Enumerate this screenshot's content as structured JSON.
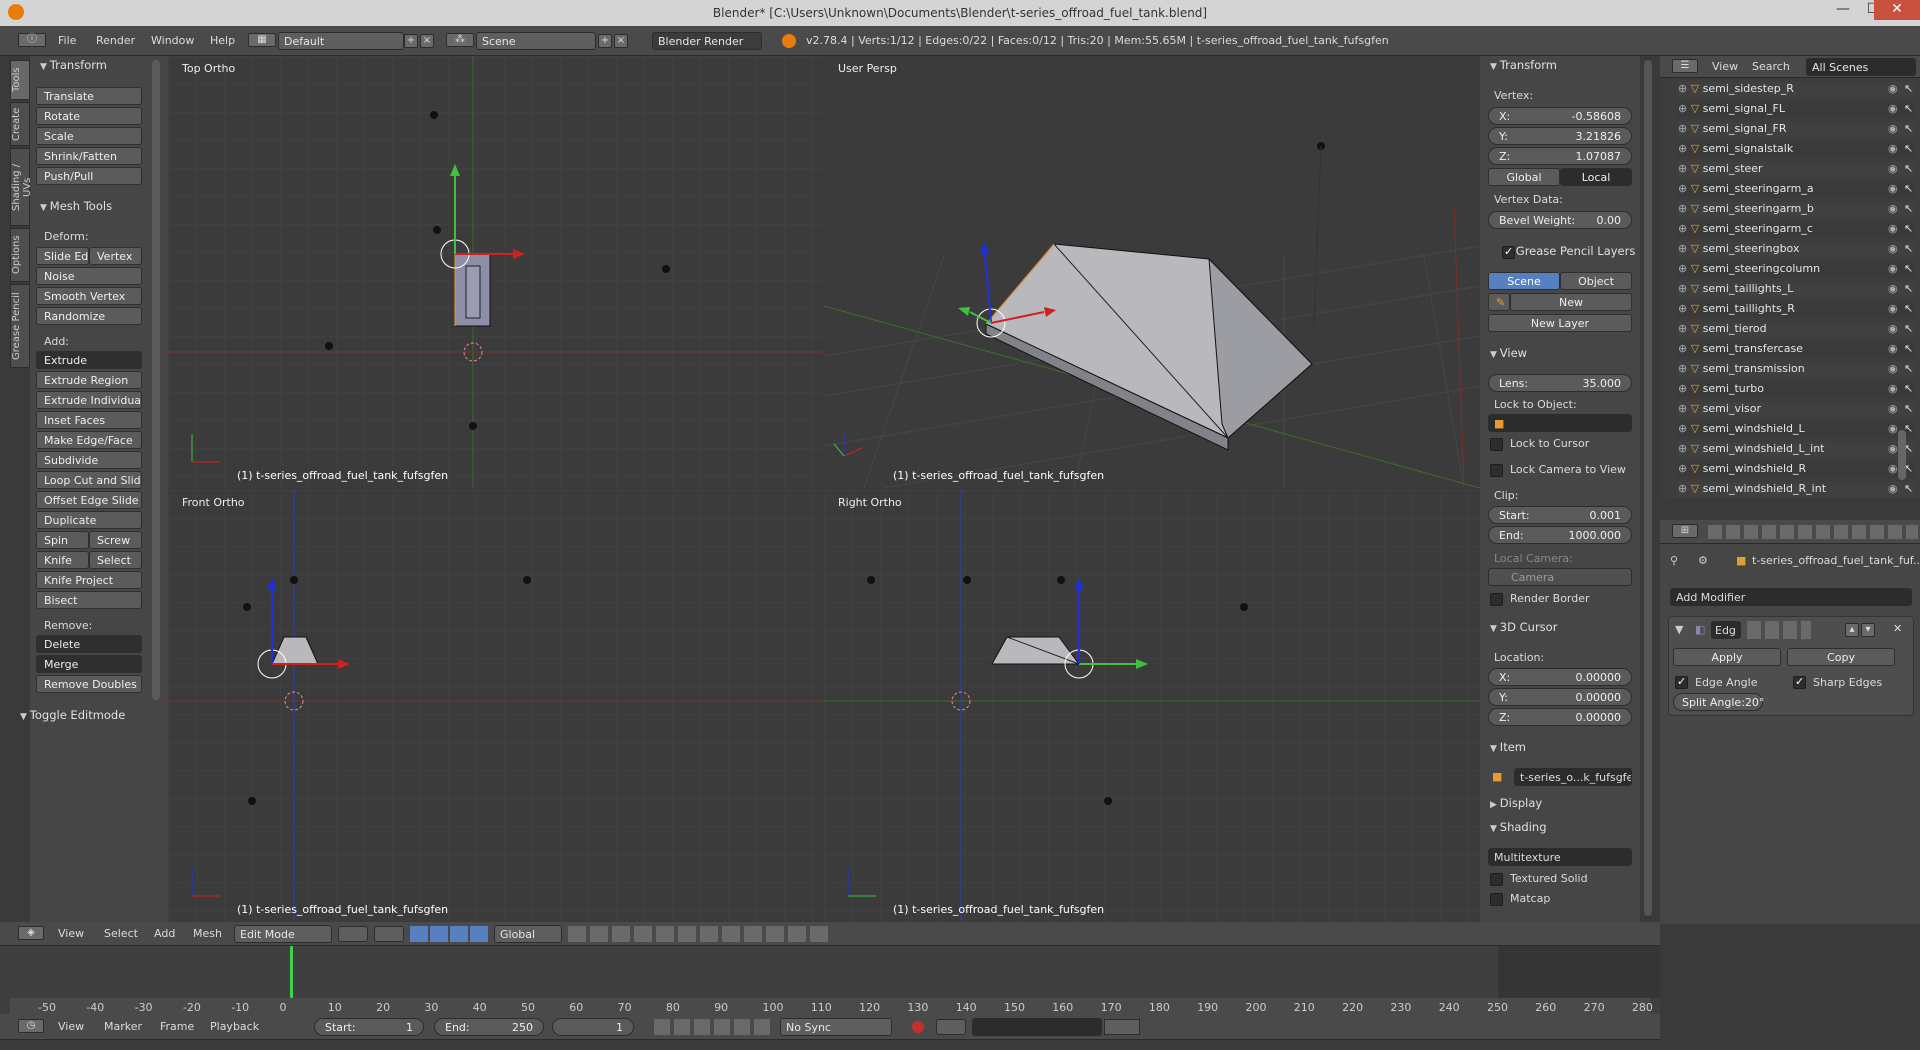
{
  "window": {
    "title": "Blender* [C:\\Users\\Unknown\\Documents\\Blender\\t-series_offroad_fuel_tank.blend]",
    "minimize": "—",
    "maximize": "☐",
    "close": "✕"
  },
  "info_header": {
    "menus": [
      "File",
      "Render",
      "Window",
      "Help"
    ],
    "layout": "Default",
    "scene": "Scene",
    "engine": "Blender Render",
    "stats": "v2.78.4 | Verts:1/12 | Edges:0/22 | Faces:0/12 | Tris:20 | Mem:55.65M | t-series_offroad_fuel_tank_fufsgfen"
  },
  "tool_tabs": [
    "Tools",
    "Create",
    "Shading / UVs",
    "Options",
    "Grease Pencil"
  ],
  "tools": {
    "transform_header": "Transform",
    "transform": [
      "Translate",
      "Rotate",
      "Scale",
      "Shrink/Fatten",
      "Push/Pull"
    ],
    "mesh_tools_header": "Mesh Tools",
    "deform_label": "Deform:",
    "slide_edge": "Slide Ed",
    "vertex": "Vertex",
    "deform": [
      "Noise",
      "Smooth Vertex",
      "Randomize"
    ],
    "add_label": "Add:",
    "extrude": "Extrude",
    "add": [
      "Extrude Region",
      "Extrude Individual",
      "Inset Faces",
      "Make Edge/Face",
      "Subdivide",
      "Loop Cut and Slide",
      "Offset Edge Slide",
      "Duplicate"
    ],
    "spin": "Spin",
    "screw": "Screw",
    "knife": "Knife",
    "select": "Select",
    "knife_project": "Knife Project",
    "bisect": "Bisect",
    "remove_label": "Remove:",
    "delete": "Delete",
    "merge": "Merge",
    "remove_doubles": "Remove Doubles",
    "toggle_editmode": "Toggle Editmode"
  },
  "viewports": {
    "top": "Top Ortho",
    "persp": "User Persp",
    "front": "Front Ortho",
    "right": "Right Ortho",
    "object_label": "(1) t-series_offroad_fuel_tank_fufsgfen"
  },
  "props": {
    "transform_header": "Transform",
    "vertex_label": "Vertex:",
    "x_label": "X:",
    "x": "-0.58608",
    "y_label": "Y:",
    "y": "3.21826",
    "z_label": "Z:",
    "z": "1.07087",
    "global": "Global",
    "local": "Local",
    "vertex_data": "Vertex Data:",
    "bevel_label": "Bevel Weight:",
    "bevel": "0.00",
    "grease_header": "Grease Pencil Layers",
    "scene_btn": "Scene",
    "object_btn": "Object",
    "new_btn": "New",
    "new_layer": "New Layer",
    "view_header": "View",
    "lens_label": "Lens:",
    "lens": "35.000",
    "lock_obj": "Lock to Object:",
    "lock_cursor": "Lock to Cursor",
    "lock_camera": "Lock Camera to View",
    "clip_label": "Clip:",
    "start_label": "Start:",
    "clip_start": "0.001",
    "end_label": "End:",
    "clip_end": "1000.000",
    "local_camera": "Local Camera:",
    "camera": "Camera",
    "render_border": "Render Border",
    "cursor_header": "3D Cursor",
    "location": "Location:",
    "cx": "0.00000",
    "cy": "0.00000",
    "cz": "0.00000",
    "item_header": "Item",
    "item_name": "t-series_o...k_fufsgfen",
    "display_header": "Display",
    "shading_header": "Shading",
    "shading_mode": "Multitexture",
    "textured_solid": "Textured Solid",
    "matcap": "Matcap"
  },
  "outliner": {
    "menus": [
      "View",
      "Search"
    ],
    "filter": "All Scenes",
    "items": [
      "semi_sidestep_R",
      "semi_signal_FL",
      "semi_signal_FR",
      "semi_signalstalk",
      "semi_steer",
      "semi_steeringarm_a",
      "semi_steeringarm_b",
      "semi_steeringarm_c",
      "semi_steeringbox",
      "semi_steeringcolumn",
      "semi_taillights_L",
      "semi_taillights_R",
      "semi_tierod",
      "semi_transfercase",
      "semi_transmission",
      "semi_turbo",
      "semi_visor",
      "semi_windshield_L",
      "semi_windshield_L_int",
      "semi_windshield_R",
      "semi_windshield_R_int"
    ]
  },
  "modifiers": {
    "breadcrumb": "t-series_offroad_fuel_tank_fuf...",
    "add_modifier": "Add Modifier",
    "mod_name": "Edg",
    "apply": "Apply",
    "copy": "Copy",
    "edge_angle": "Edge Angle",
    "sharp_edges": "Sharp Edges",
    "split_angle": "Split Angle:20°"
  },
  "view3d_header": {
    "menus": [
      "View",
      "Select",
      "Add",
      "Mesh"
    ],
    "mode": "Edit Mode",
    "orientation": "Global"
  },
  "timeline": {
    "ticks": [
      "-50",
      "-40",
      "-30",
      "-20",
      "-10",
      "0",
      "10",
      "20",
      "30",
      "40",
      "50",
      "60",
      "70",
      "80",
      "90",
      "100",
      "110",
      "120",
      "130",
      "140",
      "150",
      "160",
      "170",
      "180",
      "190",
      "200",
      "210",
      "220",
      "230",
      "240",
      "250",
      "260",
      "270",
      "280"
    ],
    "menus": [
      "View",
      "Marker",
      "Frame",
      "Playback"
    ],
    "start_label": "Start:",
    "start": "1",
    "end_label": "End:",
    "end": "250",
    "current": "1",
    "sync": "No Sync"
  },
  "colors": {
    "accent": "#5680c2",
    "x_axis": "#b03030",
    "y_axis": "#5a9a2a",
    "z_axis": "#2a3cc0",
    "orange": "#e89a34"
  }
}
